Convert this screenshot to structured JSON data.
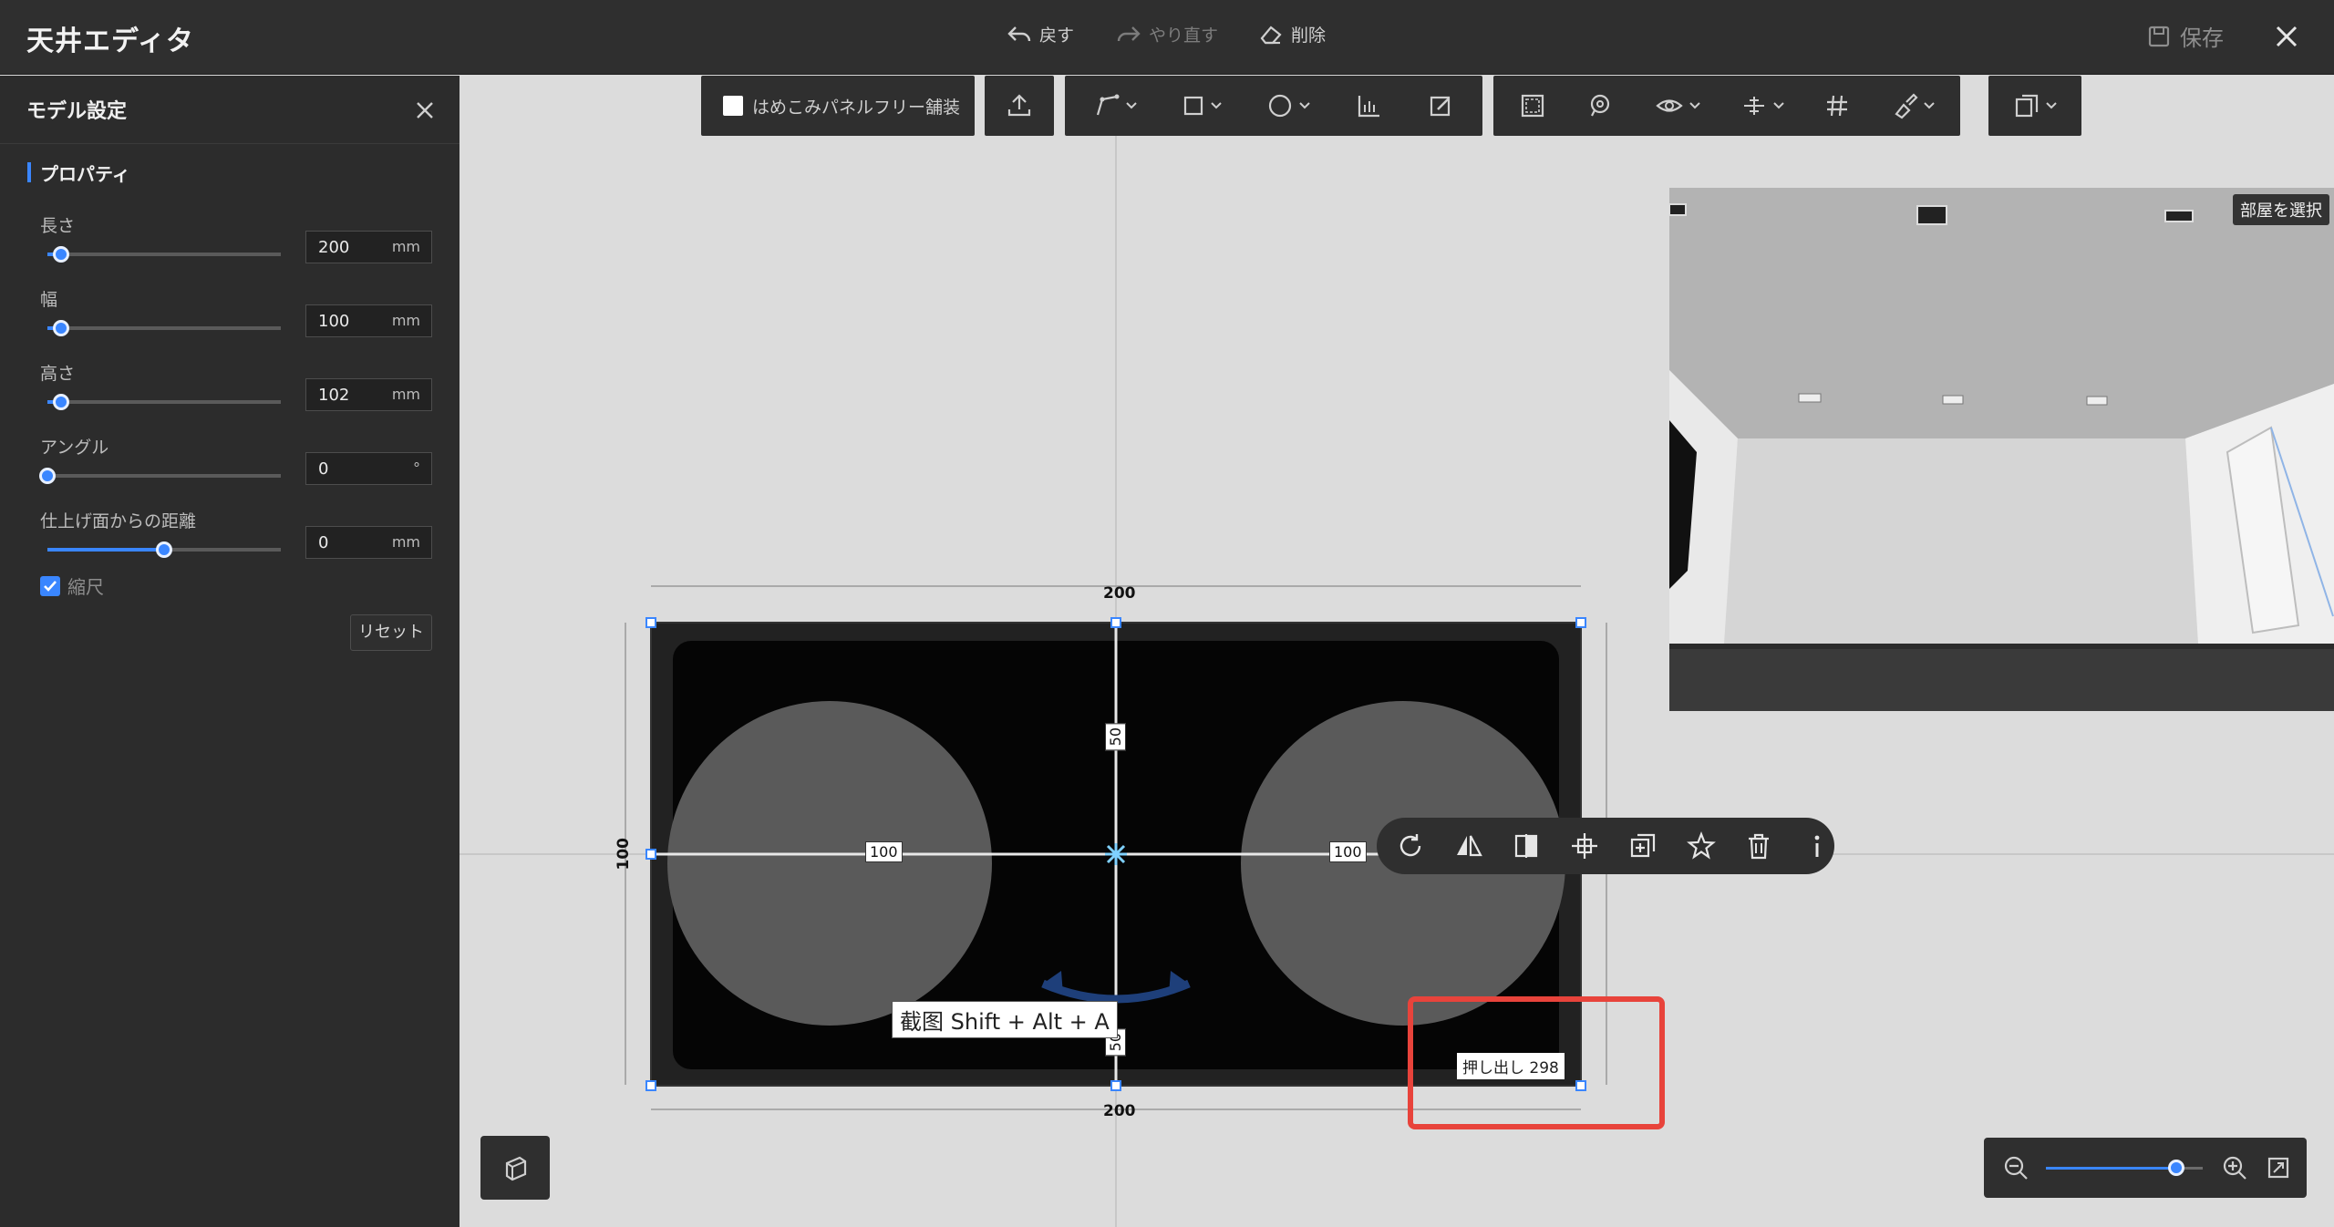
{
  "app": {
    "title": "天井エディタ"
  },
  "topbar": {
    "undo_label": "戻す",
    "redo_label": "やり直す",
    "delete_label": "削除",
    "save_label": "保存"
  },
  "panel": {
    "title": "モデル設定",
    "section_title": "プロパティ",
    "properties": [
      {
        "label": "長さ",
        "value": "200",
        "unit": "mm",
        "slider_fraction": 0.06
      },
      {
        "label": "幅",
        "value": "100",
        "unit": "mm",
        "slider_fraction": 0.06
      },
      {
        "label": "高さ",
        "value": "102",
        "unit": "mm",
        "slider_fraction": 0.06
      },
      {
        "label": "アングル",
        "value": "0",
        "unit": "°",
        "slider_fraction": 0.0
      },
      {
        "label": "仕上げ面からの距離",
        "value": "0",
        "unit": "mm",
        "slider_fraction": 0.5
      }
    ],
    "scale_label": "縮尺",
    "scale_checked": true,
    "reset_label": "リセット"
  },
  "toolbar": {
    "panel_free_label": "はめこみパネルフリー舗装"
  },
  "preview": {
    "room_select_label": "部屋を選択"
  },
  "dimensions": {
    "top_width": "200",
    "bottom_width": "200",
    "left_height": "100",
    "upper_offset": "50",
    "lower_offset": "50",
    "left_offset": "100",
    "right_offset": "100"
  },
  "hints": {
    "shortcut": "截图 Shift + Alt + A",
    "extrude": "押し出し  298"
  },
  "zoom": {
    "level_fraction": 0.83
  },
  "colors": {
    "accent": "#3a86ff",
    "highlight": "#e8433b",
    "panel_bg": "#2c2c2c"
  }
}
